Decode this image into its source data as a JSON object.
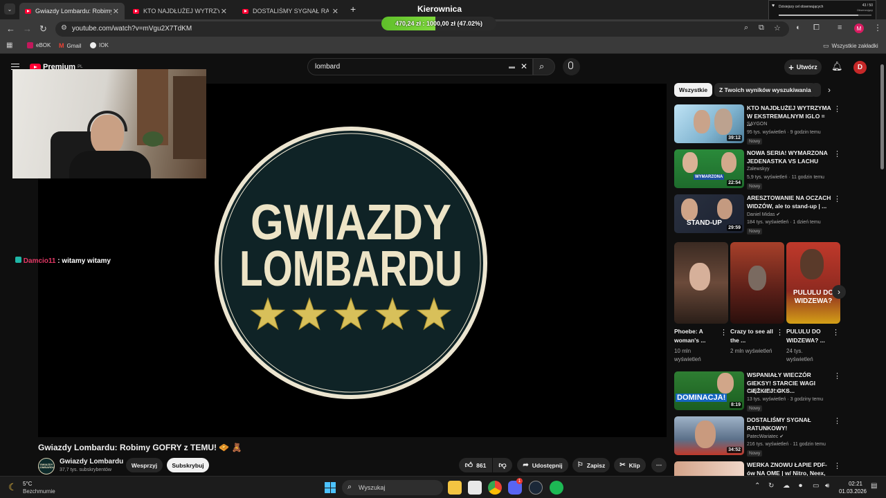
{
  "browser": {
    "tabs": [
      {
        "label": "Gwiazdy Lombardu: Robimy GO"
      },
      {
        "label": "KTO NAJDŁUŻEJ WYTRZYMA W"
      },
      {
        "label": "DOSTALIŚMY SYGNAŁ RATUNK"
      }
    ],
    "window_title": "Kierownica",
    "progress": {
      "text": "470,24 zł : 1000,00 zł (47.02%)",
      "fraction": 0.4702
    },
    "url": "youtube.com/watch?v=mVgu2X7TdKM",
    "bookmarks": [
      {
        "label": "eBOK"
      },
      {
        "label": "Gmail"
      },
      {
        "label": "IOK"
      }
    ],
    "all_bookmarks_label": "Wszystkie zakładki",
    "overlay_widget": {
      "title": "Dzisiejszy cel obserwujących",
      "count": "43 / 50",
      "sub": "Obserwujący",
      "fraction": 0.86
    }
  },
  "youtube": {
    "logo_text": "Premium",
    "logo_region": "PL",
    "search_value": "lombard",
    "create_label": "Utwórz",
    "avatar_letter": "D",
    "player": {
      "logo_line1": "GWIAZDY",
      "logo_line2": "LOMBARDU",
      "stars": 5
    },
    "chat": {
      "user": "Damcio11",
      "message": ": witamy witamy"
    },
    "video_title": "Gwiazdy Lombardu: Robimy GOFRY z TEMU! 🧇 🧸",
    "channel": {
      "avatar_text": "GWIAZDY LOMBARDU",
      "name": "Gwiazdy Lombardu",
      "subs": "37,7 tys. subskrybentów",
      "join_label": "Wesprzyj",
      "subscribe_label": "Subskrybuj"
    },
    "actions": {
      "likes": "861",
      "share": "Udostępnij",
      "save": "Zapisz",
      "clip": "Klip"
    },
    "chips": [
      {
        "label": "Wszystkie"
      },
      {
        "label": "Z Twoich wyników wyszukiwania"
      }
    ],
    "recommendations": [
      {
        "title": "KTO NAJDŁUŻEJ WYTRZYMA W EKSTREMALNYM IGLO = ...",
        "channel": "SAYGON",
        "meta": "95 tys. wyświetleń · 9 godzin temu",
        "badge": "Nowy",
        "duration": "39:12"
      },
      {
        "title": "NOWA SERIA! WYMARZONA JEDENASTKA VS LACHU",
        "channel": "Zalewskyy",
        "meta": "5,9 tys. wyświetleń · 11 godzin temu",
        "badge": "Nowy",
        "duration": "22:54",
        "overlay": "WYMARZONA"
      },
      {
        "title": "ARESZTOWANIE NA OCZACH WIDZÓW, ale to stand-up | ...",
        "channel": "Daniel Midas",
        "meta": "184 tys. wyświetleń · 1 dzień temu",
        "badge": "Nowy",
        "duration": "29:59",
        "overlay": "STAND-UP"
      },
      {
        "title": "WSPANIAŁY WIECZÓR GIEKSY! STARCIE WAGI CIĘŻKIEJ! GKS...",
        "channel": "CANAL+ SPORT",
        "meta": "13 tys. wyświetleń · 3 godziny temu",
        "badge": "Nowy",
        "duration": "8:19",
        "overlay": "DOMINACJA!"
      },
      {
        "title": "DOSTALIŚMY SYGNAŁ RATUNKOWY!",
        "channel": "PatecWariatec",
        "meta": "216 tys. wyświetleń · 11 godzin temu",
        "badge": "Nowy",
        "duration": "34:52"
      },
      {
        "title": "WERKA ZNOWU ŁAPIE PDF-ów NA OME | w/ Nitro, Neex, ..."
      }
    ],
    "shorts": [
      {
        "title": "Phoebe: A woman's ...",
        "views": "10 mln wyświetleń"
      },
      {
        "title": "Crazy to see all the ...",
        "views": "2 mln wyświetleń"
      },
      {
        "title": "PULULU DO WIDZEWA? ...",
        "views": "24 tys. wyświetleń",
        "overlay": "PULULU DO WIDZEWA?"
      }
    ]
  },
  "taskbar": {
    "weather_temp": "5°C",
    "weather_desc": "Bezchmurnie",
    "search_placeholder": "Wyszukaj",
    "time": "02:21",
    "date": "01.03.2026",
    "discord_badge": "1"
  }
}
